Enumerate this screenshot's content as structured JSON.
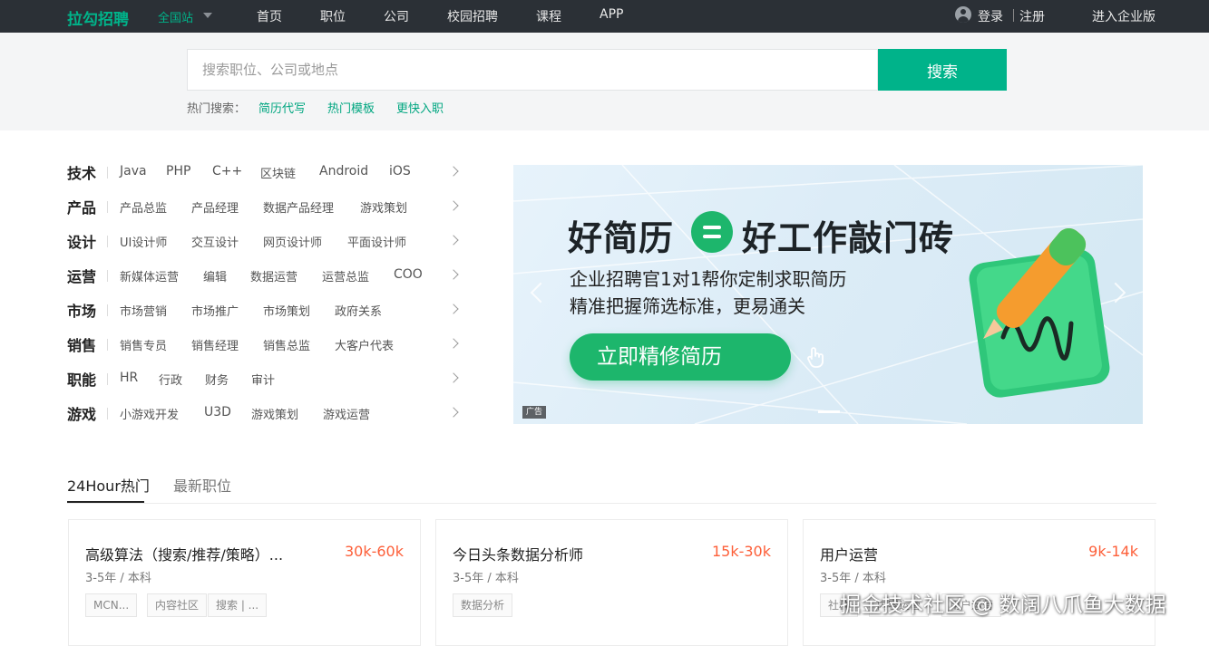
{
  "header": {
    "logo": "拉勾招聘",
    "site_selector": "全国站",
    "nav": [
      "首页",
      "职位",
      "公司",
      "校园招聘",
      "课程",
      "APP"
    ],
    "login": "登录",
    "register": "注册",
    "enterprise": "进入企业版"
  },
  "search": {
    "placeholder": "搜索职位、公司或地点",
    "button": "搜索",
    "hot_label": "热门搜索：",
    "hot_links": [
      "简历代写",
      "热门模板",
      "更快入职"
    ]
  },
  "categories": [
    {
      "title": "技术",
      "items": [
        "Java",
        "PHP",
        "C++",
        "区块链",
        "Android",
        "iOS"
      ]
    },
    {
      "title": "产品",
      "items": [
        "产品总监",
        "产品经理",
        "数据产品经理",
        "游戏策划"
      ]
    },
    {
      "title": "设计",
      "items": [
        "UI设计师",
        "交互设计",
        "网页设计师",
        "平面设计师"
      ]
    },
    {
      "title": "运营",
      "items": [
        "新媒体运营",
        "编辑",
        "数据运营",
        "运营总监",
        "COO"
      ]
    },
    {
      "title": "市场",
      "items": [
        "市场营销",
        "市场推广",
        "市场策划",
        "政府关系"
      ]
    },
    {
      "title": "销售",
      "items": [
        "销售专员",
        "销售经理",
        "销售总监",
        "大客户代表"
      ]
    },
    {
      "title": "职能",
      "items": [
        "HR",
        "行政",
        "财务",
        "审计"
      ]
    },
    {
      "title": "游戏",
      "items": [
        "小游戏开发",
        "U3D",
        "游戏策划",
        "游戏运营"
      ]
    }
  ],
  "banner": {
    "headline_left": "好简历",
    "headline_right": "好工作敲门砖",
    "line1": "企业招聘官1对1帮你定制求职简历",
    "line2": "精准把握筛选标准，更易通关",
    "cta": "立即精修简历",
    "ad_badge": "广告"
  },
  "tabs": [
    "24Hour热门",
    "最新职位"
  ],
  "jobs": [
    {
      "title": "高级算法（搜索/推荐/策略）...",
      "salary": "30k-60k",
      "req": "3-5年 / 本科",
      "tags": [
        "MCN...",
        "内容社区",
        "搜索 | ..."
      ]
    },
    {
      "title": "今日头条数据分析师",
      "salary": "15k-30k",
      "req": "3-5年 / 本科",
      "tags": [
        "数据分析"
      ]
    },
    {
      "title": "用户运营",
      "salary": "9k-14k",
      "req": "3-5年 / 本科",
      "tags": [
        "社群",
        "内容运营",
        "用户运营"
      ]
    }
  ],
  "watermark": "掘金技术社区 @ 数阔八爪鱼大数据",
  "colors": {
    "accent": "#00b38a",
    "salary": "#fd5f39",
    "topbar": "#2b3036",
    "cta": "#1db66c"
  }
}
